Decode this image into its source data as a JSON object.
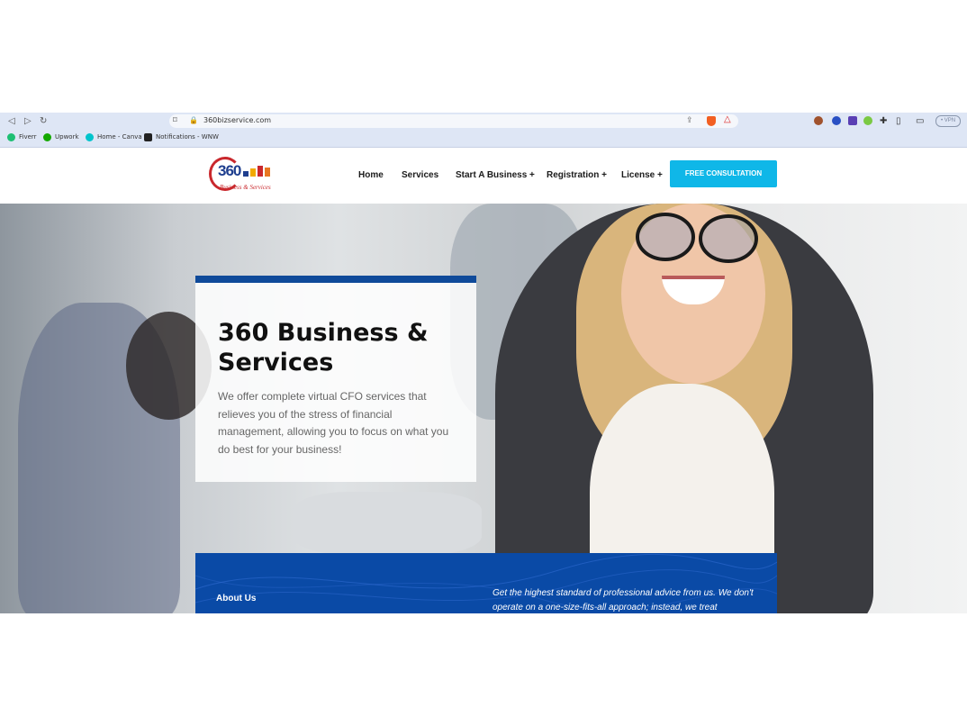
{
  "browser": {
    "url": "360bizservice.com",
    "vpn_label": "• VPN",
    "bookmarks": [
      {
        "label": "Fiverr",
        "color": "#1dbf73"
      },
      {
        "label": "Upwork",
        "color": "#14a800"
      },
      {
        "label": "Home - Canva",
        "color": "#00c4cc"
      },
      {
        "label": "Notifications - WNW",
        "color": "#222222"
      }
    ]
  },
  "header": {
    "logo_number": "360",
    "logo_tagline": "Business & Services",
    "menu": [
      "Home",
      "Services",
      "Start A Business +",
      "Registration +",
      "License +"
    ],
    "cta_label": "FREE CONSULTATION"
  },
  "hero": {
    "title": "360 Business & Services",
    "text": "We offer complete virtual CFO services that relieves you of the stress of financial management, allowing you to focus on what you do best for your business!"
  },
  "band": {
    "about_label": "About Us",
    "quote": "Get the highest standard of professional advice from us. We don't operate on a one-size-fits-all approach; instead, we treat"
  },
  "colors": {
    "accent": "#0fb7e8",
    "primary_blue": "#0a4aa6",
    "logo_red": "#c9282d"
  }
}
